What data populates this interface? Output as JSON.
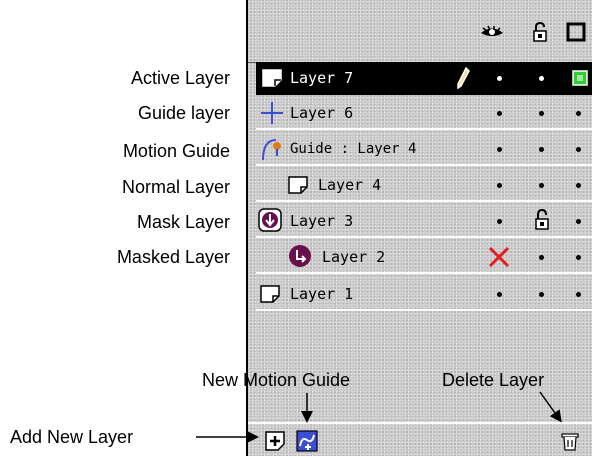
{
  "annotations": {
    "active_layer": "Active Layer",
    "guide_layer": "Guide layer",
    "motion_guide": "Motion Guide",
    "normal_layer": "Normal Layer",
    "mask_layer": "Mask Layer",
    "masked_layer": "Masked Layer",
    "new_motion_guide": "New Motion Guide",
    "delete_layer": "Delete Layer",
    "add_new_layer": "Add New Layer"
  },
  "header": {
    "icons": [
      "eye-icon",
      "lock-icon",
      "outline-icon"
    ]
  },
  "layers": [
    {
      "name": "Layer 7",
      "type": "normal",
      "active": true
    },
    {
      "name": "Layer 6",
      "type": "guide"
    },
    {
      "name": "Guide : Layer 4",
      "type": "motion-guide"
    },
    {
      "name": "Layer 4",
      "type": "normal"
    },
    {
      "name": "Layer 3",
      "type": "mask",
      "locked": true
    },
    {
      "name": "Layer 2",
      "type": "masked",
      "hidden": true
    },
    {
      "name": "Layer 1",
      "type": "normal"
    }
  ],
  "colors": {
    "active_row": "#000000",
    "outline_swatch": "#33cc33",
    "hidden_x": "#e02020",
    "guide_icon": "#3a4fd6",
    "masked_icon": "#6a0f4e"
  }
}
